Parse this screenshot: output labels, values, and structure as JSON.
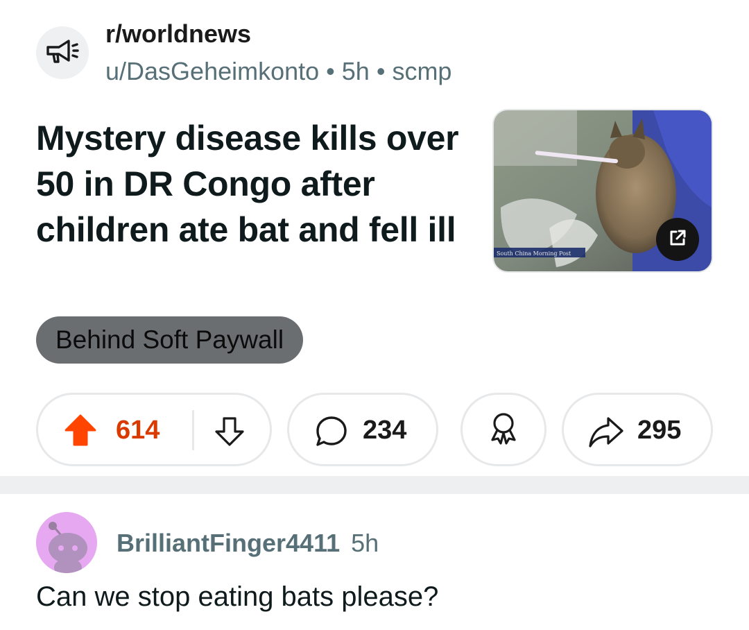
{
  "post": {
    "subreddit": "r/worldnews",
    "author": "u/DasGeheimkonto",
    "age": "5h",
    "domain": "scmp",
    "meta_separator": "•",
    "title": "Mystery disease kills over 50 in DR Congo after children ate bat and fell ill",
    "thumbnail_caption": "South China Morning Post",
    "flair": "Behind Soft Paywall"
  },
  "actions": {
    "score": "614",
    "comments": "234",
    "shares": "295"
  },
  "comment": {
    "username": "BrilliantFinger4411",
    "age": "5h",
    "text": "Can we stop eating bats please?"
  },
  "colors": {
    "upvote_active": "#ff4500",
    "score_text": "#d93a00",
    "flair_bg": "#6b6e71",
    "avatar_bg": "#e7a8f2"
  },
  "icons": {
    "subreddit": "megaphone-icon",
    "upvote": "arrow-up-icon",
    "downvote": "arrow-down-icon",
    "comments": "speech-bubble-icon",
    "award": "award-icon",
    "share": "share-arrow-icon",
    "external": "external-link-icon"
  }
}
